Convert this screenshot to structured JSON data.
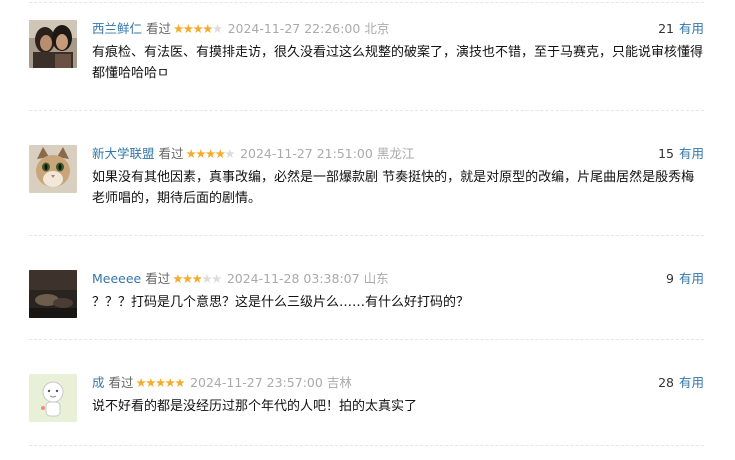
{
  "useful_label": "有用",
  "colors": {
    "link": "#3377aa",
    "star": "#f6ac2b",
    "star_off": "#dddddd",
    "meta": "#aaaaaa",
    "divider": "#e6e6e6"
  },
  "comments": [
    {
      "user": "西兰鲜仁",
      "watched": "看过",
      "rating": 4,
      "time": "2024-11-27 22:26:00",
      "location": "北京",
      "votes": "21",
      "content": "有痕检、有法医、有摸排走访，很久没看过这么规整的破案了，演技也不错，至于马赛克，只能说审核懂得都懂哈哈哈ㅁ",
      "avatar": "couple-photo"
    },
    {
      "user": "新大学联盟",
      "watched": "看过",
      "rating": 4,
      "time": "2024-11-27 21:51:00",
      "location": "黑龙江",
      "votes": "15",
      "content": "如果没有其他因素，真事改编，必然是一部爆款剧 节奏挺快的，就是对原型的改编，片尾曲居然是殷秀梅老师唱的，期待后面的剧情。",
      "avatar": "cat-photo"
    },
    {
      "user": "Meeeee",
      "watched": "看过",
      "rating": 3,
      "time": "2024-11-28 03:38:07",
      "location": "山东",
      "votes": "9",
      "content": "？？？打码是几个意思？这是什么三级片么……有什么好打码的？",
      "avatar": "dark-scene-photo"
    },
    {
      "user": "成",
      "watched": "看过",
      "rating": 5,
      "time": "2024-11-27 23:57:00",
      "location": "吉林",
      "votes": "28",
      "content": "说不好看的都是没经历过那个年代的人吧！拍的太真实了",
      "avatar": "cartoon-figure"
    }
  ]
}
